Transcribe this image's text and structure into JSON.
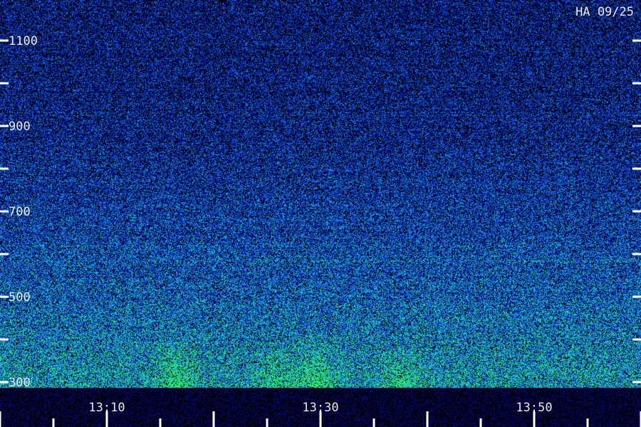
{
  "chart_data": {
    "type": "heatmap",
    "title": "HA 09/25",
    "xlabel": "",
    "ylabel": "",
    "x_ticks": [
      {
        "label": "13:10",
        "minute": 10
      },
      {
        "label": "13:30",
        "minute": 30
      },
      {
        "label": "13:50",
        "minute": 50
      }
    ],
    "y_ticks": [
      {
        "label": "1100",
        "value": 1100
      },
      {
        "label": "900",
        "value": 900
      },
      {
        "label": "700",
        "value": 700
      },
      {
        "label": "500",
        "value": 500
      },
      {
        "label": "300",
        "value": 300
      }
    ],
    "x_range_minutes": [
      0,
      60
    ],
    "y_range": [
      300,
      1150
    ],
    "colormap": [
      "#000000",
      "#0a0a80",
      "#1030d0",
      "#1a80e0",
      "#20c8c8",
      "#30f060"
    ],
    "intensity_profile": {
      "note_y": [
        300,
        500,
        700,
        900,
        1100
      ],
      "mean_intensity": [
        0.72,
        0.55,
        0.42,
        0.3,
        0.26
      ]
    },
    "bursts": [
      {
        "minute": 16.5,
        "y_top": 430,
        "strength": 0.8
      },
      {
        "minute": 25.5,
        "y_top": 400,
        "strength": 0.6
      },
      {
        "minute": 29.5,
        "y_top": 420,
        "strength": 0.85
      },
      {
        "minute": 37.5,
        "y_top": 400,
        "strength": 0.7
      }
    ]
  }
}
